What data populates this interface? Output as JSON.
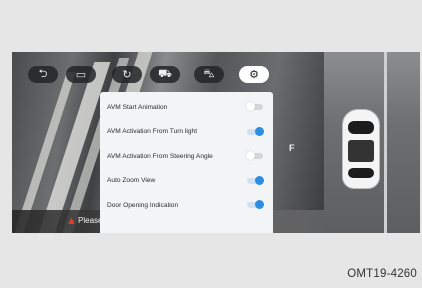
{
  "topbar": {
    "buttons": [
      {
        "name": "back-button",
        "icon": "back-arrow-icon",
        "glyph": "⮌",
        "active": false
      },
      {
        "name": "camera-view-button",
        "icon": "camera-icon",
        "glyph": "▭",
        "active": false
      },
      {
        "name": "3d-view-button",
        "icon": "3d-rotate-icon",
        "glyph": "↻",
        "active": false
      },
      {
        "name": "front-view-button",
        "icon": "car-front-icon",
        "glyph": "⛟",
        "active": false
      },
      {
        "name": "side-view-button",
        "icon": "car-side-icon",
        "glyph": "⛍",
        "active": false
      },
      {
        "name": "settings-button",
        "icon": "gear-icon",
        "glyph": "⚙",
        "active": true
      }
    ]
  },
  "settings": {
    "items": [
      {
        "label": "AVM Start Animation",
        "enabled": false
      },
      {
        "label": "AVM Activation From Turn light",
        "enabled": true
      },
      {
        "label": "AVM Activation From Steering Angle",
        "enabled": false
      },
      {
        "label": "Auto Zoom View",
        "enabled": true
      },
      {
        "label": "Door Opening Indication",
        "enabled": true
      }
    ]
  },
  "overlay": {
    "marker": "F",
    "warning": "Please"
  },
  "caption": "OMT19-4260",
  "colors": {
    "toggle_on": "#2d8de0",
    "toggle_off": "#d4d6d8",
    "warning": "#e23b2b"
  }
}
